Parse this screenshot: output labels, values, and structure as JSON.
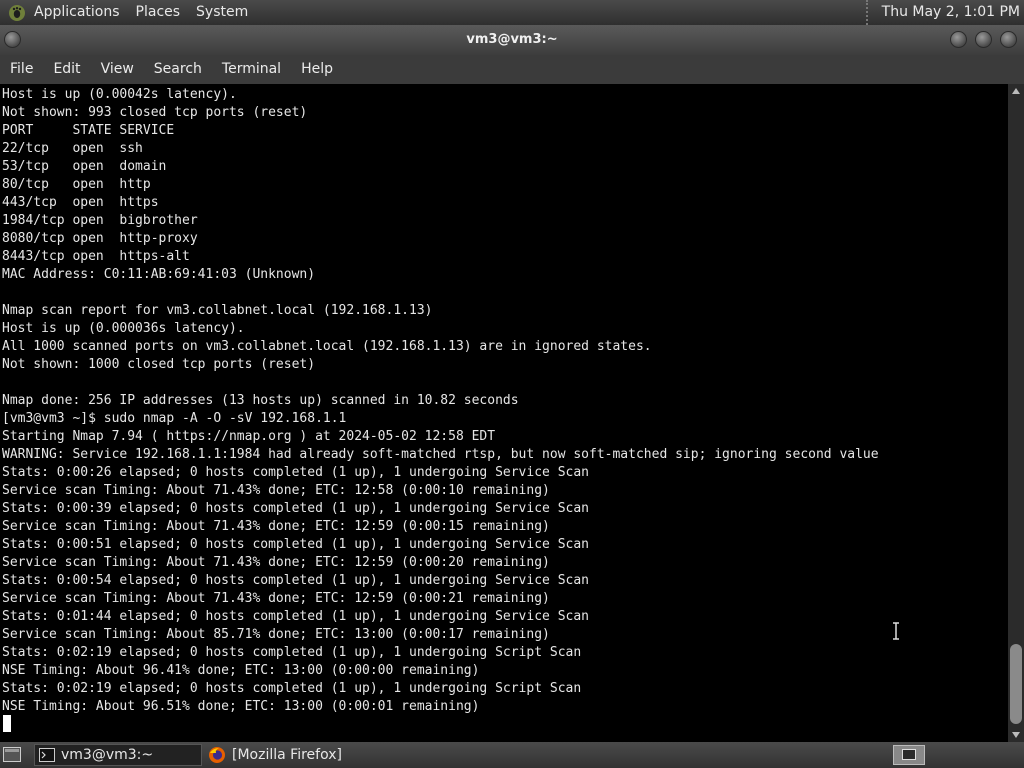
{
  "top_panel": {
    "menus": [
      "Applications",
      "Places",
      "System"
    ],
    "clock": "Thu May  2,  1:01 PM"
  },
  "window": {
    "title": "vm3@vm3:~"
  },
  "menubar": [
    "File",
    "Edit",
    "View",
    "Search",
    "Terminal",
    "Help"
  ],
  "terminal": {
    "lines": [
      "Host is up (0.00042s latency).",
      "Not shown: 993 closed tcp ports (reset)",
      "PORT     STATE SERVICE",
      "22/tcp   open  ssh",
      "53/tcp   open  domain",
      "80/tcp   open  http",
      "443/tcp  open  https",
      "1984/tcp open  bigbrother",
      "8080/tcp open  http-proxy",
      "8443/tcp open  https-alt",
      "MAC Address: C0:11:AB:69:41:03 (Unknown)",
      "",
      "Nmap scan report for vm3.collabnet.local (192.168.1.13)",
      "Host is up (0.000036s latency).",
      "All 1000 scanned ports on vm3.collabnet.local (192.168.1.13) are in ignored states.",
      "Not shown: 1000 closed tcp ports (reset)",
      "",
      "Nmap done: 256 IP addresses (13 hosts up) scanned in 10.82 seconds",
      "[vm3@vm3 ~]$ sudo nmap -A -O -sV 192.168.1.1",
      "Starting Nmap 7.94 ( https://nmap.org ) at 2024-05-02 12:58 EDT",
      "WARNING: Service 192.168.1.1:1984 had already soft-matched rtsp, but now soft-matched sip; ignoring second value",
      "Stats: 0:00:26 elapsed; 0 hosts completed (1 up), 1 undergoing Service Scan",
      "Service scan Timing: About 71.43% done; ETC: 12:58 (0:00:10 remaining)",
      "Stats: 0:00:39 elapsed; 0 hosts completed (1 up), 1 undergoing Service Scan",
      "Service scan Timing: About 71.43% done; ETC: 12:59 (0:00:15 remaining)",
      "Stats: 0:00:51 elapsed; 0 hosts completed (1 up), 1 undergoing Service Scan",
      "Service scan Timing: About 71.43% done; ETC: 12:59 (0:00:20 remaining)",
      "Stats: 0:00:54 elapsed; 0 hosts completed (1 up), 1 undergoing Service Scan",
      "Service scan Timing: About 71.43% done; ETC: 12:59 (0:00:21 remaining)",
      "Stats: 0:01:44 elapsed; 0 hosts completed (1 up), 1 undergoing Service Scan",
      "Service scan Timing: About 85.71% done; ETC: 13:00 (0:00:17 remaining)",
      "Stats: 0:02:19 elapsed; 0 hosts completed (1 up), 1 undergoing Script Scan",
      "NSE Timing: About 96.41% done; ETC: 13:00 (0:00:00 remaining)",
      "Stats: 0:02:19 elapsed; 0 hosts completed (1 up), 1 undergoing Script Scan",
      "NSE Timing: About 96.51% done; ETC: 13:00 (0:00:01 remaining)"
    ]
  },
  "taskbar": {
    "tasks": [
      "vm3@vm3:~",
      "[Mozilla Firefox]"
    ]
  },
  "icons": {
    "gnome_foot": "gnome-foot-icon",
    "terminal": "terminal-icon",
    "firefox": "firefox-icon",
    "show_desktop": "show-desktop-icon",
    "workspace": "workspace-switcher-icon"
  },
  "colors": {
    "terminal_bg": "#000000",
    "terminal_fg": "#e6e6e6",
    "panel_bg": "#3b3b3b"
  }
}
